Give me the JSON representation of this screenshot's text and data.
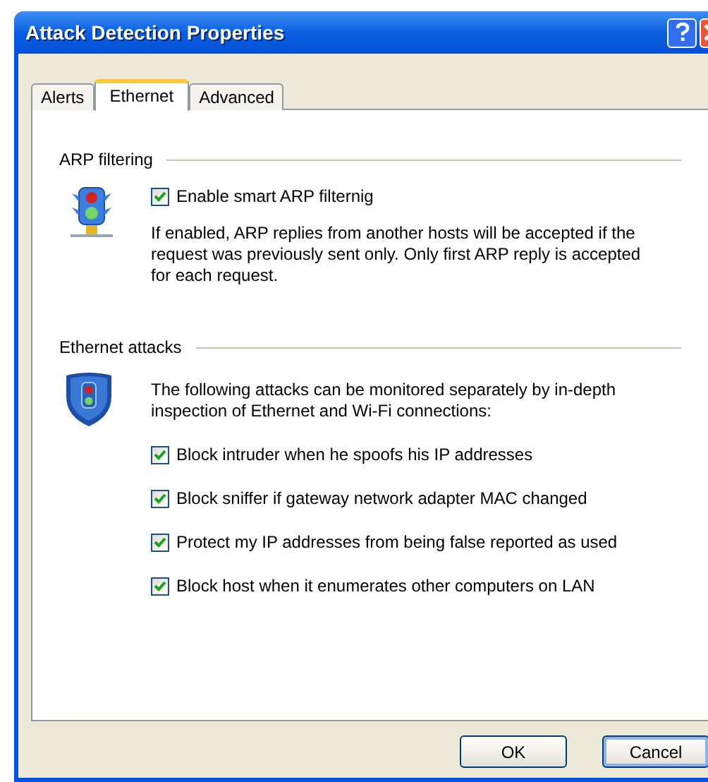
{
  "window": {
    "title": "Attack Detection Properties"
  },
  "tabs": [
    {
      "label": "Alerts",
      "selected": false
    },
    {
      "label": "Ethernet",
      "selected": true
    },
    {
      "label": "Advanced",
      "selected": false
    }
  ],
  "sections": [
    {
      "heading": "ARP filtering",
      "kind": "light",
      "blocks": [
        {
          "kind": "option",
          "label": "Enable smart ARP filternig",
          "checked": true
        },
        {
          "kind": "description",
          "text": "If enabled, ARP replies from another hosts will be accepted if the request was previously sent only. Only first ARP reply is accepted for each request."
        }
      ]
    },
    {
      "heading": "Ethernet attacks",
      "kind": "shield",
      "blocks": [
        {
          "kind": "description",
          "text": "The following attacks can be monitored separately by in-depth inspection of Ethernet and Wi-Fi connections:"
        },
        {
          "kind": "option",
          "label": "Block intruder when he spoofs his IP addresses",
          "checked": true
        },
        {
          "kind": "option",
          "label": "Block sniffer if gateway network adapter MAC changed",
          "checked": true
        },
        {
          "kind": "option",
          "label": "Protect my IP addresses from being false reported as used",
          "checked": true
        },
        {
          "kind": "option",
          "label": "Block host when it enumerates other computers on LAN",
          "checked": true
        }
      ]
    }
  ],
  "buttons": [
    {
      "label": "OK",
      "default": false
    },
    {
      "label": "Cancel",
      "default": true
    }
  ]
}
